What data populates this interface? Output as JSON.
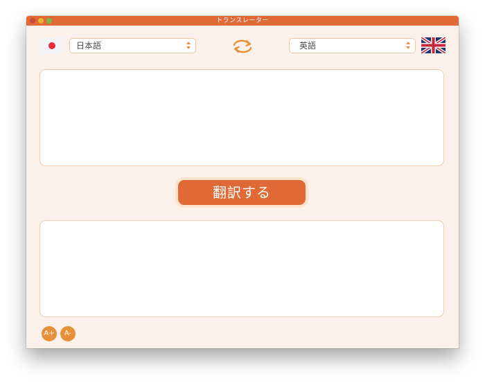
{
  "window": {
    "title": "トランスレーター"
  },
  "source": {
    "flag_icon": "japan-flag-icon",
    "language": "日本語"
  },
  "swap": {
    "icon": "swap-arrows-icon"
  },
  "target": {
    "flag_icon": "uk-flag-icon",
    "language": "英語"
  },
  "input_text": {
    "value": ""
  },
  "output_text": {
    "value": ""
  },
  "translate_button": {
    "label": "翻訳する"
  },
  "font_controls": {
    "increase_label": "A+",
    "decrease_label": "A-"
  },
  "colors": {
    "accent": "#e06a36",
    "accent_light": "#e6913a",
    "background": "#fcf1ea",
    "border": "#eecfb0"
  }
}
